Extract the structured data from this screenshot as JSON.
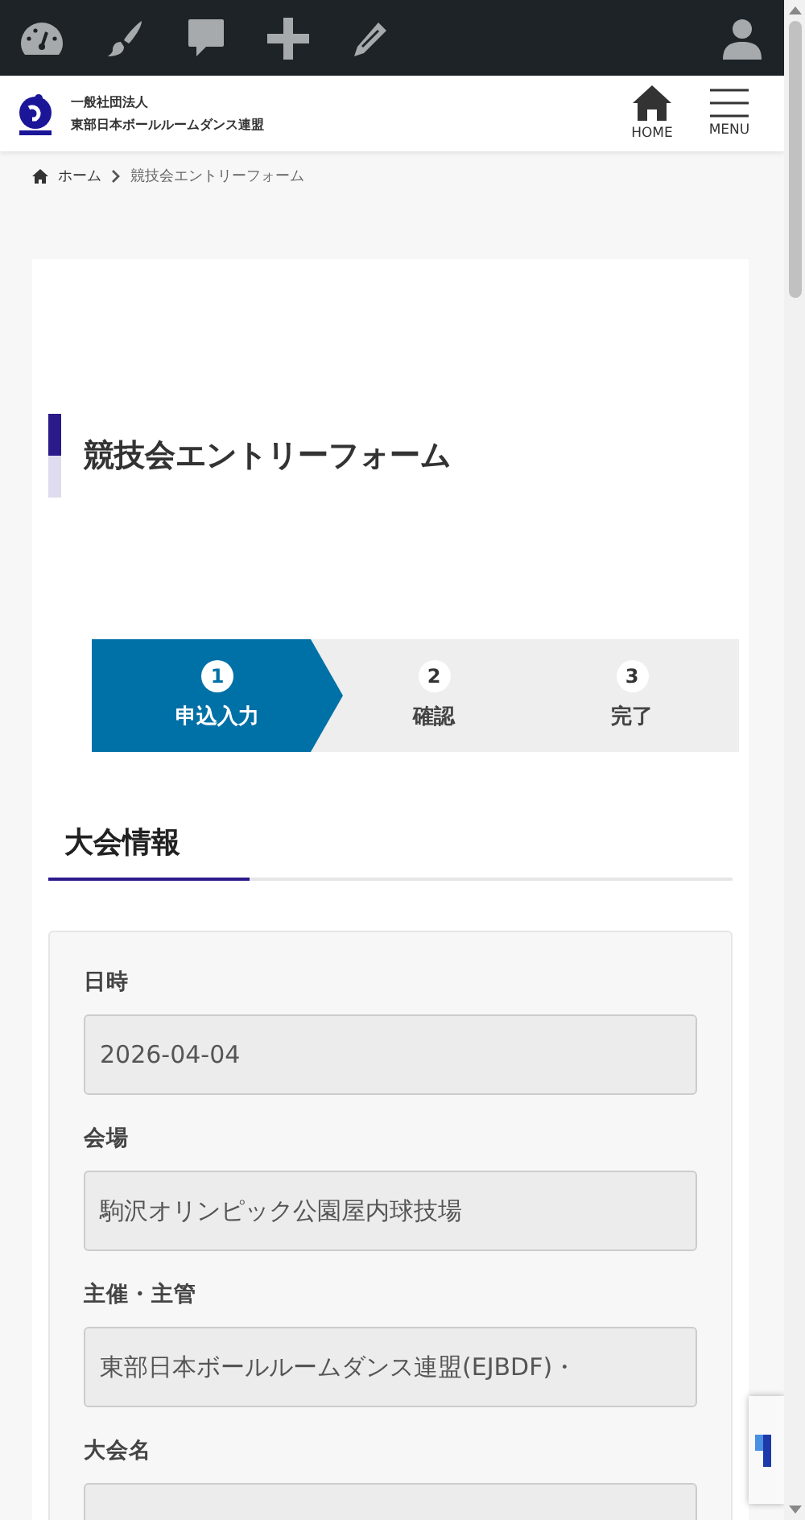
{
  "header": {
    "org_lines": [
      "一般社団法人",
      "東部日本ボールルームダンス連盟"
    ],
    "nav": [
      {
        "label": "HOME",
        "kind": "home"
      },
      {
        "label": "MENU",
        "kind": "menu"
      }
    ]
  },
  "breadcrumb": [
    "ホーム",
    "競技会エントリーフォーム"
  ],
  "page_title": "競技会エントリーフォーム",
  "steps": [
    {
      "number": "1",
      "label": "申込入力",
      "selected": true
    },
    {
      "number": "2",
      "label": "確認",
      "selected": false
    },
    {
      "number": "3",
      "label": "完了",
      "selected": false
    }
  ],
  "section_heading": "大会情報",
  "fields": [
    {
      "label": "日時",
      "value": "2026-04-04"
    },
    {
      "label": "会場",
      "value": "駒沢オリンピック公園屋内球技場"
    },
    {
      "label": "主催・主管",
      "value": "東部日本ボールルームダンス連盟(EJBDF)・"
    },
    {
      "label": "大会名"
    }
  ]
}
